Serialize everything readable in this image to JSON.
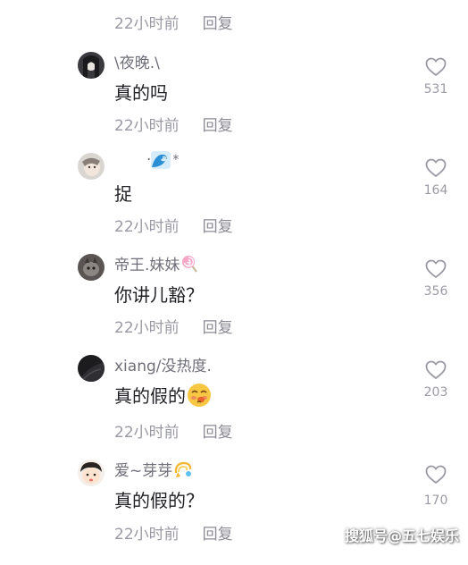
{
  "top_row": {
    "time": "22小时前",
    "reply": "回复"
  },
  "comments": [
    {
      "username": "\\夜晚.\\",
      "text": "真的吗",
      "likes": "531",
      "time": "22小时前",
      "reply": "回复"
    },
    {
      "username": "·",
      "text": "捉",
      "likes": "164",
      "time": "22小时前",
      "reply": "回复"
    },
    {
      "username": "帝王.妹妹",
      "text": "你讲儿豁？",
      "likes": "356",
      "time": "22小时前",
      "reply": "回复"
    },
    {
      "username": "xiang/没热度.",
      "text": "真的假的",
      "likes": "203",
      "time": "22小时前",
      "reply": "回复"
    },
    {
      "username": "爱~芽芽",
      "text": "真的假的？",
      "likes": "170",
      "time": "22小时前",
      "reply": "回复"
    }
  ],
  "watermark": "搜狐号@五七娱乐",
  "icons": {
    "like": "heart-outline-icon"
  }
}
